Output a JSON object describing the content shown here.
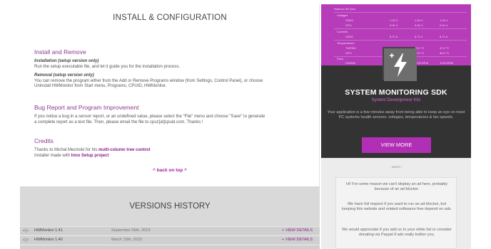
{
  "main": {
    "install_title": "INSTALL & CONFIGURATION",
    "install_remove": {
      "heading": "Install and Remove",
      "installation_label": "Installation (setup version only)",
      "installation_text": "Run the setup executable file, and let it guide you for the installation process.",
      "removal_label": "Removal (setup version only)",
      "removal_text_1": "You can remove the program either from the Add or Remove Programs window (from Settings, Control Panel), or choose",
      "removal_text_2": "Uninstall HWMonitor from Start menu, Programs, CPUID, HWMonitor."
    },
    "bug_report": {
      "heading": "Bug Report and Program Improvement",
      "text_1": "If you notice a bug in a sensor report, or an undefined value, please select the \"File\" menu and choose \"Save\" to generate",
      "text_2": "a complete report as a text file. Then, please email the file to cpuz[at]cpuid.com. Thanks !"
    },
    "credits": {
      "heading": "Credits",
      "line1_prefix": "Thanks to Michal Mecinski for his ",
      "line1_link": "multi-column tree control",
      "line2_prefix": "Installer made with ",
      "line2_link": "Inno Setup project"
    },
    "back_to_top": "^ back on top ^"
  },
  "versions": {
    "title": "VERSIONS HISTORY",
    "rows": [
      {
        "icon": "<|>",
        "name": "HWMonitor 1.41",
        "date": "September 06th, 2019",
        "link": "+ VIEW DETAILS"
      },
      {
        "icon": "<|>",
        "name": "HWMonitor 1.40",
        "date": "March 15th, 2019",
        "link": "+ VIEW DETAILS"
      }
    ]
  },
  "sidebar": {
    "sensor_panel": {
      "rows": [
        {
          "label": "Radeon HD 3xxx",
          "v1": "",
          "v2": "",
          "v3": ""
        },
        {
          "label": "Voltages",
          "v1": "",
          "v2": "",
          "v3": ""
        },
        {
          "label": "VDDC",
          "v1": "1.09 V",
          "v2": "1.09 V",
          "v3": "1.09 V"
        },
        {
          "label": "GPU",
          "v1": "0.91 V",
          "v2": "0.91 V",
          "v3": "0.91 V"
        },
        {
          "label": "Currents",
          "v1": "",
          "v2": "",
          "v3": ""
        },
        {
          "label": "VDDC",
          "v1": "8.71 A",
          "v2": "8.71 A",
          "v3": "8.71 A"
        },
        {
          "label": "Temperatures",
          "v1": "",
          "v2": "",
          "v3": ""
        },
        {
          "label": "TMPIN0",
          "v1": "46.0 °C",
          "v2": "46.0 °C",
          "v3": "47.0 °C"
        },
        {
          "label": "GPU",
          "v1": "46.0 °C",
          "v2": "46.0 °C",
          "v3": "46.0 °C"
        },
        {
          "label": "Fans",
          "v1": "",
          "v2": "",
          "v3": ""
        },
        {
          "label": "FANIN0",
          "v1": "1229 RPM",
          "v2": "1229 RPM",
          "v3": "1229 RPM"
        }
      ]
    },
    "sdk": {
      "title": "SYSTEM MONITORING SDK",
      "subtitle": "System Development Kits",
      "description": "Your application is a few minutes away from being able to keep an eye on most PC systems health sensors: voltages, temperatures & fan speeds.",
      "button_label": "VIEW MORE"
    },
    "advert": {
      "label": "- advert -",
      "p1": "Hi! For some reason we can't display an ad here, probably because of an ad blocker.",
      "p2": "We have full respect if you want to run an ad blocker, but keeping this website and related softwares free depend on ads.",
      "p3": "We would appreciate if you add us to your white list or consider donating via Paypal if ads really bother you."
    }
  },
  "colors": {
    "accent": "#b12fb4",
    "heading_purple": "#8a3b8a",
    "sdk_bg": "#333333",
    "versions_bg": "#d9d9d9"
  }
}
